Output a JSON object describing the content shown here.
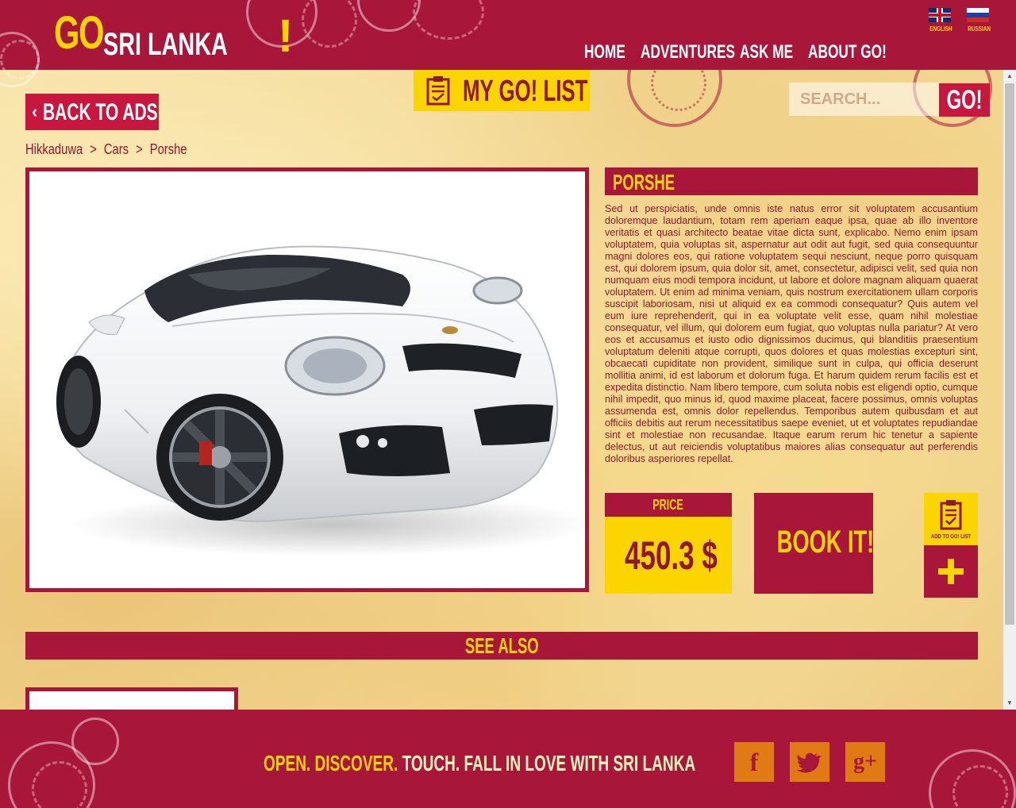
{
  "header": {
    "logo": {
      "go": "GO",
      "name": "SRI LANKA",
      "bang": "!"
    },
    "nav": [
      "HOME",
      "ADVENTURES",
      "ASK ME",
      "ABOUT GO!"
    ],
    "languages": [
      {
        "label": "ENGLISH",
        "icon": "uk-flag-icon"
      },
      {
        "label": "RUSSIAN",
        "icon": "russia-flag-icon"
      }
    ]
  },
  "toolbar": {
    "back_label": "BACK TO ADS",
    "mygolist_label": "MY GO! LIST",
    "search_placeholder": "SEARCH...",
    "search_button": "GO!"
  },
  "breadcrumb": [
    "Hikkaduwa",
    ">",
    "Cars",
    ">",
    "Porshe"
  ],
  "listing": {
    "title": "PORSHE",
    "description": "Sed ut perspiciatis, unde omnis iste natus error sit voluptatem accusantium doloremque laudantium, totam rem aperiam eaque ipsa, quae ab illo inventore veritatis et quasi architecto beatae vitae dicta sunt, explicabo. Nemo enim ipsam voluptatem, quia voluptas sit, aspernatur aut odit aut fugit, sed quia consequuntur magni dolores eos, qui ratione voluptatem sequi nesciunt, neque porro quisquam est, qui dolorem ipsum, quia dolor sit, amet, consectetur, adipisci velit, sed quia non numquam eius modi tempora incidunt, ut labore et dolore magnam aliquam quaerat voluptatem. Ut enim ad minima veniam, quis nostrum exercitationem ullam corporis suscipit laboriosam, nisi ut aliquid ex ea commodi consequatur? Quis autem vel eum iure reprehenderit, qui in ea voluptate velit esse, quam nihil molestiae consequatur, vel illum, qui dolorem eum fugiat, quo voluptas nulla pariatur? At vero eos et accusamus et iusto odio dignissimos ducimus, qui blanditiis praesentium voluptatum deleniti atque corrupti, quos dolores et quas molestias excepturi sint, obcaecati cupiditate non provident, similique sunt in culpa, qui officia deserunt mollitia animi, id est laborum et dolorum fuga. Et harum quidem rerum facilis est et expedita distinctio. Nam libero tempore, cum soluta nobis est eligendi optio, cumque nihil impedit, quo minus id, quod maxime placeat, facere possimus, omnis voluptas assumenda est, omnis dolor repellendus. Temporibus autem quibusdam et aut officiis debitis aut rerum necessitatibus saepe eveniet, ut et voluptates repudiandae sint et molestiae non recusandae. Itaque earum rerum hic tenetur a sapiente delectus, ut aut reiciendis voluptatibus maiores alias consequatur aut perferendis doloribus asperiores repellat.",
    "price_label": "PRICE",
    "price_value": "450.3 $",
    "book_label": "BOOK IT!",
    "add_to_list_label": "ADD TO GO! LIST",
    "image": "white-sports-car-image"
  },
  "see_also": {
    "title": "SEE ALSO"
  },
  "footer": {
    "slogan": [
      "OPEN.",
      "DISCOVER.",
      "TOUCH.",
      "FALL IN LOVE WITH SRI LANKA"
    ],
    "social": [
      {
        "glyph": "f",
        "icon": "facebook-icon"
      },
      {
        "glyph": "t",
        "icon": "twitter-icon"
      },
      {
        "glyph": "g+",
        "icon": "google-plus-icon"
      }
    ]
  },
  "colors": {
    "primary": "#a8163a",
    "accent": "#fcd400",
    "dark_text": "#8f1732",
    "social": "#e07a12"
  }
}
